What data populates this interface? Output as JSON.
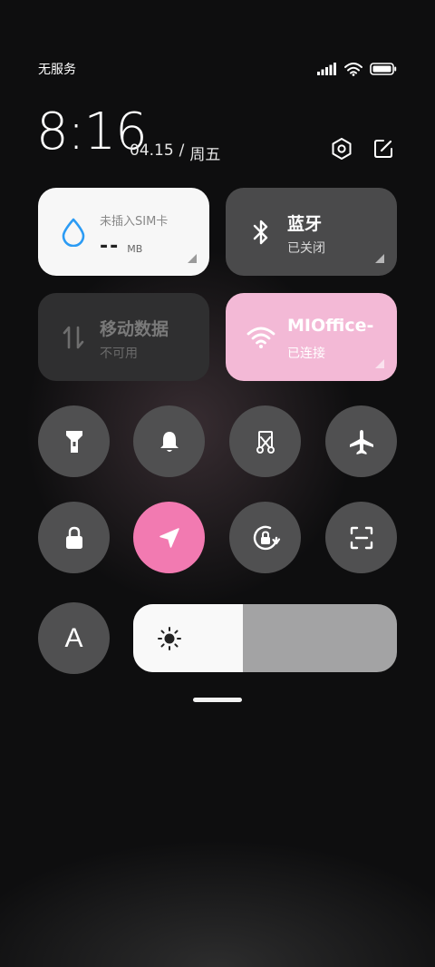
{
  "status_bar": {
    "carrier": "无服务",
    "icons": [
      "signal-icon",
      "wifi-icon",
      "battery-icon"
    ]
  },
  "header": {
    "time": "8:16",
    "date": "04.15",
    "separator": "/",
    "weekday": "周五",
    "buttons": [
      "settings-icon",
      "edit-icon"
    ]
  },
  "tiles": {
    "data": {
      "title": "未插入SIM卡",
      "value": "--",
      "unit": "MB",
      "icon": "water-drop-icon"
    },
    "bluetooth": {
      "title": "蓝牙",
      "status": "已关闭",
      "icon": "bluetooth-icon"
    },
    "mobile_data": {
      "title": "移动数据",
      "status": "不可用",
      "icon": "mobile-data-icon"
    },
    "wifi": {
      "title": "MIOffice-",
      "status": "已连接",
      "icon": "wifi-icon"
    }
  },
  "toggles": [
    {
      "name": "flashlight",
      "icon": "flashlight-icon",
      "active": false
    },
    {
      "name": "bell",
      "icon": "bell-icon",
      "active": false
    },
    {
      "name": "screenshot",
      "icon": "scissors-icon",
      "active": false
    },
    {
      "name": "airplane",
      "icon": "airplane-icon",
      "active": false
    },
    {
      "name": "lock",
      "icon": "lock-icon",
      "active": false
    },
    {
      "name": "location",
      "icon": "location-arrow-icon",
      "active": true
    },
    {
      "name": "rotation-lock",
      "icon": "rotation-lock-icon",
      "active": false
    },
    {
      "name": "scanner",
      "icon": "scan-icon",
      "active": false
    }
  ],
  "font_toggle": {
    "label": "A"
  },
  "brightness": {
    "level": 0.415,
    "icon": "sun-icon"
  },
  "colors": {
    "accent": "#f27ab1",
    "wifi_tile": "#f3b9d6",
    "tile_dark": "#4a4a4b",
    "data_icon": "#2b9bf4"
  }
}
